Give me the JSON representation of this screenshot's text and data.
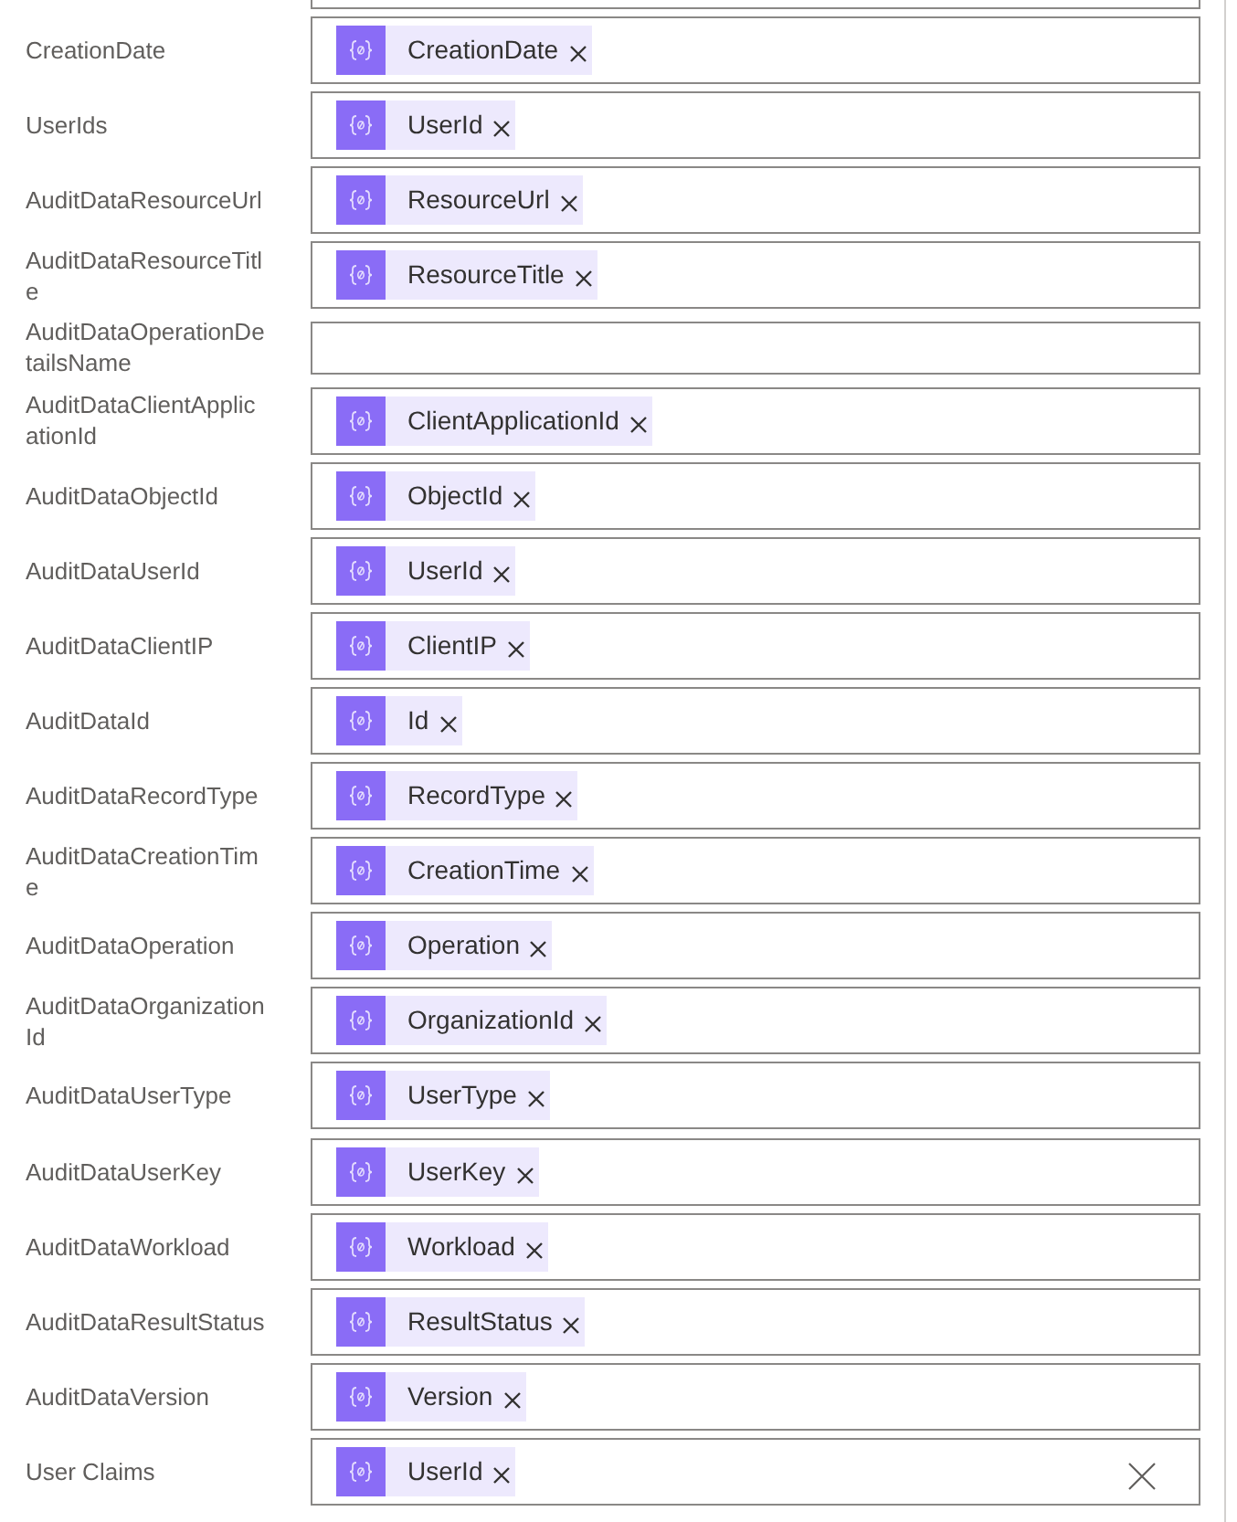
{
  "fields": [
    {
      "kind": "clipped"
    },
    {
      "kind": "input",
      "label": "CreationDate",
      "tokens": [
        "CreationDate"
      ]
    },
    {
      "kind": "input",
      "label": "UserIds",
      "tokens": [
        "UserId"
      ]
    },
    {
      "kind": "input",
      "label": "AuditDataResourceUrl",
      "tokens": [
        "ResourceUrl"
      ]
    },
    {
      "kind": "input",
      "label": "AuditDataResourceTitle",
      "tokens": [
        "ResourceTitle"
      ]
    },
    {
      "kind": "input",
      "label": "AuditDataOperationDetailsName"
    },
    {
      "kind": "input",
      "label": "AuditDataClientApplicationId",
      "tokens": [
        "ClientApplicationId"
      ]
    },
    {
      "kind": "input",
      "label": "AuditDataObjectId",
      "tokens": [
        "ObjectId"
      ]
    },
    {
      "kind": "input",
      "label": "AuditDataUserId",
      "tokens": [
        "UserId"
      ]
    },
    {
      "kind": "input",
      "label": "AuditDataClientIP",
      "tokens": [
        "ClientIP"
      ]
    },
    {
      "kind": "input",
      "label": "AuditDataId",
      "tokens": [
        "Id"
      ]
    },
    {
      "kind": "input",
      "label": "AuditDataRecordType",
      "tokens": [
        "RecordType"
      ]
    },
    {
      "kind": "input",
      "label": "AuditDataCreationTime",
      "tokens": [
        "CreationTime"
      ]
    },
    {
      "kind": "input",
      "label": "AuditDataOperation",
      "tokens": [
        "Operation"
      ]
    },
    {
      "kind": "input",
      "label": "AuditDataOrganizationId",
      "tokens": [
        "OrganizationId"
      ]
    },
    {
      "kind": "input",
      "label": "AuditDataUserType",
      "tokens": [
        "UserType"
      ]
    },
    {
      "kind": "input",
      "label": "AuditDataUserKey",
      "tokens": [
        "UserKey"
      ]
    },
    {
      "kind": "input",
      "label": "AuditDataWorkload",
      "tokens": [
        "Workload"
      ]
    },
    {
      "kind": "input",
      "label": "AuditDataResultStatus",
      "tokens": [
        "ResultStatus"
      ]
    },
    {
      "kind": "input",
      "label": "AuditDataVersion",
      "tokens": [
        "Version"
      ]
    },
    {
      "kind": "input",
      "label": "User Claims",
      "tokens": [
        "UserId"
      ],
      "clear_button": true
    }
  ]
}
